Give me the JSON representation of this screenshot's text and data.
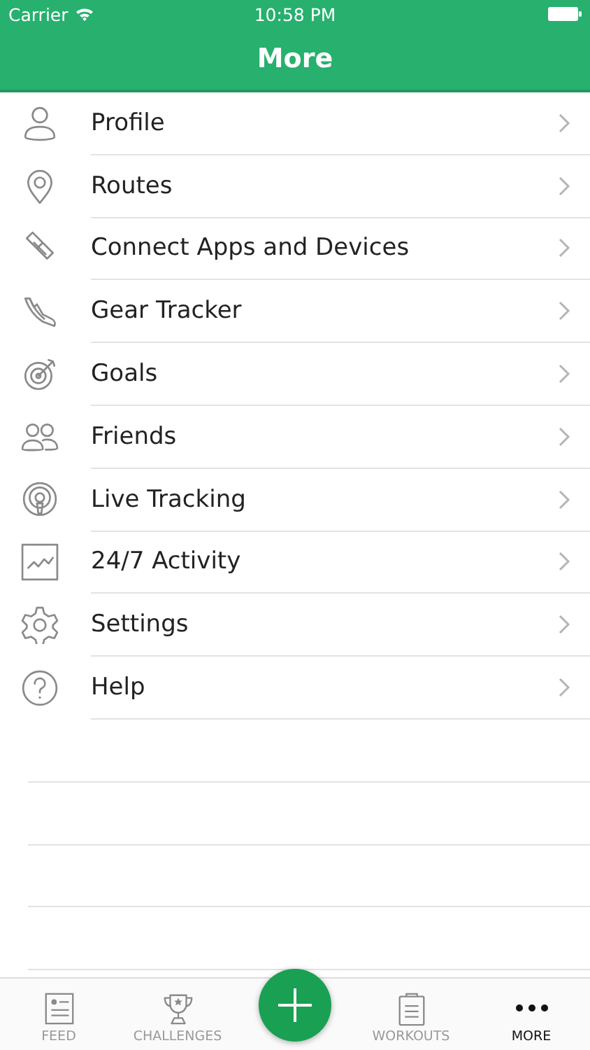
{
  "status_bar": {
    "carrier": "Carrier",
    "time": "10:58 PM"
  },
  "nav_bar": {
    "title": "More"
  },
  "menu": [
    {
      "label": "Profile"
    },
    {
      "label": "Routes"
    },
    {
      "label": "Connect Apps and Devices"
    },
    {
      "label": "Gear Tracker"
    },
    {
      "label": "Goals"
    },
    {
      "label": "Friends"
    },
    {
      "label": "Live Tracking"
    },
    {
      "label": "24/7 Activity"
    },
    {
      "label": "Settings"
    },
    {
      "label": "Help"
    }
  ],
  "tab_bar": [
    {
      "label": "FEED",
      "selected": false
    },
    {
      "label": "CHALLENGES",
      "selected": false
    },
    {
      "kind": "add"
    },
    {
      "label": "WORKOUTS",
      "selected": false
    },
    {
      "label": "MORE",
      "selected": true
    }
  ]
}
